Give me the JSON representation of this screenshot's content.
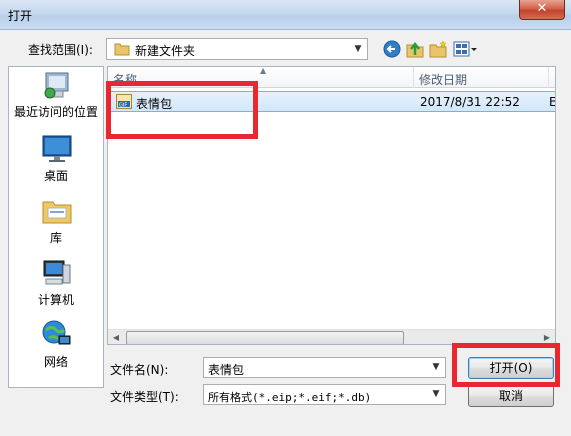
{
  "window": {
    "title": "打开",
    "close_glyph": "✕"
  },
  "lookin": {
    "label": "查找范围(I):",
    "value": "新建文件夹"
  },
  "toolbar": {
    "icons": [
      "back-icon",
      "up-folder-icon",
      "new-folder-icon",
      "view-menu-icon"
    ]
  },
  "places": [
    {
      "label": "最近访问的位置",
      "icon": "recent-places-icon"
    },
    {
      "label": "桌面",
      "icon": "desktop-icon"
    },
    {
      "label": "库",
      "icon": "libraries-icon"
    },
    {
      "label": "计算机",
      "icon": "computer-icon"
    },
    {
      "label": "网络",
      "icon": "network-icon"
    }
  ],
  "filelist": {
    "columns": [
      "名称",
      "修改日期",
      "E"
    ],
    "rows": [
      {
        "name": "表情包",
        "modified": "2017/8/31 22:52",
        "extra": "E",
        "icon": "gif-file-icon"
      }
    ]
  },
  "filename": {
    "label": "文件名(N):",
    "value": "表情包"
  },
  "filetype": {
    "label": "文件类型(T):",
    "value": "所有格式(*.eip;*.eif;*.db)"
  },
  "buttons": {
    "open": "打开(O)",
    "cancel": "取消"
  },
  "colors": {
    "highlight_box": "#e8282e",
    "selection": "#d3e7f9"
  }
}
